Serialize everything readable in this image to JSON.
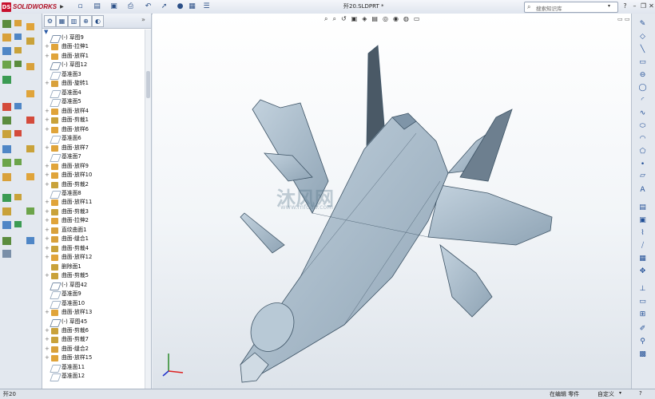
{
  "app": {
    "name": "SOLIDWORKS",
    "brand_color": "#c8102e"
  },
  "document": {
    "title": "歼20.SLDPRT *"
  },
  "search": {
    "placeholder": "搜索知识库"
  },
  "tree_items": [
    {
      "label": "(-) 草图9",
      "icon": "sketch-icon",
      "expanded": false
    },
    {
      "label": "曲面-拉伸1",
      "icon": "surface-extrude-icon",
      "expanded": true
    },
    {
      "label": "曲面-放样1",
      "icon": "surface-loft-icon",
      "expanded": true
    },
    {
      "label": "(-) 草图12",
      "icon": "sketch-icon",
      "expanded": false
    },
    {
      "label": "基准面3",
      "icon": "plane-icon",
      "expanded": false
    },
    {
      "label": "曲面-旋转1",
      "icon": "surface-revolve-icon",
      "expanded": true
    },
    {
      "label": "基准面4",
      "icon": "plane-icon",
      "expanded": false
    },
    {
      "label": "基准面5",
      "icon": "plane-icon",
      "expanded": false
    },
    {
      "label": "曲面-放样4",
      "icon": "surface-loft-icon",
      "expanded": true
    },
    {
      "label": "曲面-剪裁1",
      "icon": "surface-trim-icon",
      "expanded": true
    },
    {
      "label": "曲面-放样6",
      "icon": "surface-loft-icon",
      "expanded": true
    },
    {
      "label": "基准面6",
      "icon": "plane-icon",
      "expanded": false
    },
    {
      "label": "曲面-放样7",
      "icon": "surface-loft-icon",
      "expanded": true
    },
    {
      "label": "基准面7",
      "icon": "plane-icon",
      "expanded": false
    },
    {
      "label": "曲面-放样9",
      "icon": "surface-loft-icon",
      "expanded": true
    },
    {
      "label": "曲面-放样10",
      "icon": "surface-loft-icon",
      "expanded": true
    },
    {
      "label": "曲面-剪裁2",
      "icon": "surface-trim-icon",
      "expanded": true
    },
    {
      "label": "基准面8",
      "icon": "plane-icon",
      "expanded": false
    },
    {
      "label": "曲面-放样11",
      "icon": "surface-loft-icon",
      "expanded": true
    },
    {
      "label": "曲面-剪裁3",
      "icon": "surface-trim-icon",
      "expanded": true
    },
    {
      "label": "曲面-拉伸2",
      "icon": "surface-extrude-icon",
      "expanded": true
    },
    {
      "label": "直纹曲面1",
      "icon": "ruled-surface-icon",
      "expanded": true
    },
    {
      "label": "曲面-缝合1",
      "icon": "surface-knit-icon",
      "expanded": true
    },
    {
      "label": "曲面-剪裁4",
      "icon": "surface-trim-icon",
      "expanded": true
    },
    {
      "label": "曲面-放样12",
      "icon": "surface-loft-icon",
      "expanded": true
    },
    {
      "label": "删除面1",
      "icon": "delete-face-icon",
      "expanded": false
    },
    {
      "label": "曲面-剪裁5",
      "icon": "surface-trim-icon",
      "expanded": true
    },
    {
      "label": "(-) 草图42",
      "icon": "sketch-icon",
      "expanded": false
    },
    {
      "label": "基准面9",
      "icon": "plane-icon",
      "expanded": false
    },
    {
      "label": "基准面10",
      "icon": "plane-icon",
      "expanded": false
    },
    {
      "label": "曲面-放样13",
      "icon": "surface-loft-icon",
      "expanded": true
    },
    {
      "label": "(-) 草图45",
      "icon": "sketch-icon",
      "expanded": false
    },
    {
      "label": "曲面-剪裁6",
      "icon": "surface-trim-icon",
      "expanded": true
    },
    {
      "label": "曲面-剪裁7",
      "icon": "surface-trim-icon",
      "expanded": true
    },
    {
      "label": "曲面-缝合2",
      "icon": "surface-knit-icon",
      "expanded": true
    },
    {
      "label": "曲面-放样15",
      "icon": "surface-loft-icon",
      "expanded": true
    },
    {
      "label": "基准面11",
      "icon": "plane-icon",
      "expanded": false
    },
    {
      "label": "基准面12",
      "icon": "plane-icon",
      "expanded": false
    }
  ],
  "watermark": {
    "text": "沐风网",
    "sub": "www.mfcad.com"
  },
  "status": {
    "left": "歼20",
    "mode": "在编辑 零件",
    "units": "自定义"
  },
  "colors": {
    "model_fill": "#a9bccb",
    "model_edge": "#3e5466",
    "viewport_top": "#ffffff",
    "viewport_bottom": "#dde3ea"
  }
}
